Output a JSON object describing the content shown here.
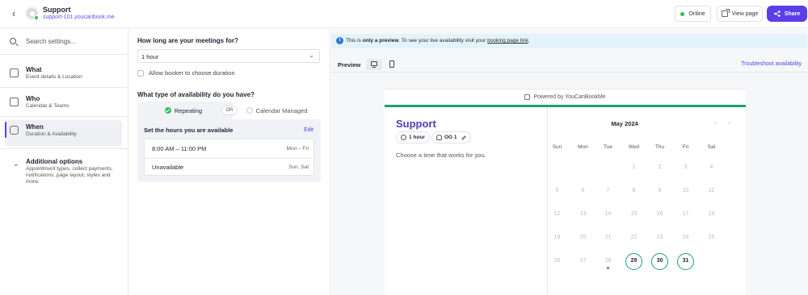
{
  "header": {
    "back_icon": "chevron-left-icon",
    "page_name": "Support",
    "page_url": "support-101.youcanbook.me",
    "online_label": "Online",
    "view_page_label": "View page",
    "share_label": "Share",
    "status_color": "#2ebd59",
    "accent_color": "#5b3ee8"
  },
  "sidebar": {
    "search_placeholder": "Search settings...",
    "items": [
      {
        "title": "What",
        "sub": "Event details & Location",
        "icon": "calendar-doc-icon"
      },
      {
        "title": "Who",
        "sub": "Calendar & Teams",
        "icon": "people-icon"
      },
      {
        "title": "When",
        "sub": "Duration & Availability",
        "icon": "watch-icon",
        "active": true
      },
      {
        "title": "Additional options",
        "sub": "Appointment types, collect payments, notifications, page layout, styles and more.",
        "icon": "chevron-down-icon"
      }
    ]
  },
  "settings": {
    "duration_question": "How long are your meetings for?",
    "duration_value": "1 hour",
    "allow_booker_label": "Allow booker to choose duration",
    "availability_question": "What type of availability do you have?",
    "repeating_label": "Repeating",
    "or_label": "OR",
    "calendar_managed_label": "Calendar Managed",
    "hours_title": "Set the hours you are available",
    "edit_label": "Edit",
    "hours": [
      {
        "time": "8:00 AM – 11:00 PM",
        "days": "Mon – Fri"
      },
      {
        "time": "Unavailable",
        "days": "Sun, Sat"
      }
    ]
  },
  "preview": {
    "banner_prefix": "This is ",
    "banner_bold": "only a preview",
    "banner_middle": ". To see your live availability visit your ",
    "banner_link": "booking page link",
    "banner_suffix": ".",
    "preview_label": "Preview",
    "troubleshoot_label": "Troubleshoot availability",
    "powered_by": "Powered by YouCanBookMe",
    "booking_title": "Support",
    "duration_pill": "1 hour",
    "host_pill": "OG 1",
    "choose_text": "Choose a time that works for you.",
    "month_label": "May 2024",
    "weekdays": [
      "Sun",
      "Mon",
      "Tue",
      "Wed",
      "Thu",
      "Fri",
      "Sat"
    ],
    "weeks": [
      [
        "",
        "",
        "",
        "1",
        "2",
        "3",
        "4"
      ],
      [
        "5",
        "6",
        "7",
        "8",
        "9",
        "10",
        "11"
      ],
      [
        "12",
        "13",
        "14",
        "15",
        "16",
        "17",
        "18"
      ],
      [
        "19",
        "20",
        "21",
        "22",
        "23",
        "24",
        "25"
      ],
      [
        "26",
        "27",
        "28",
        "29",
        "30",
        "31",
        ""
      ]
    ],
    "available_days": [
      "29",
      "30",
      "31"
    ],
    "today": "28",
    "available_color": "#1f9e7a"
  }
}
